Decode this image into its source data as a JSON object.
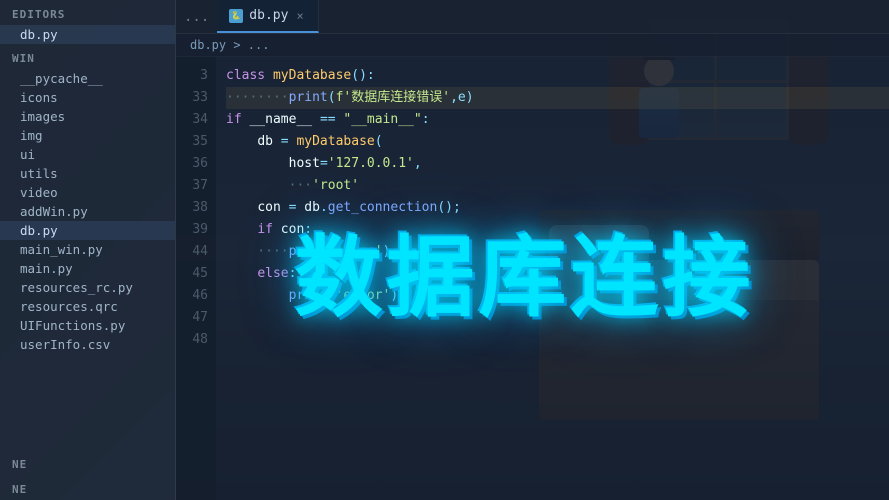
{
  "sidebar": {
    "editors_label": "EDITORS",
    "win_label": "WIN",
    "active_file": "db.py",
    "files": [
      {
        "name": "db.py",
        "active": true,
        "indent": 0
      },
      {
        "name": "__pycache__",
        "indent": 0,
        "is_folder": true
      },
      {
        "name": "icons",
        "indent": 0,
        "is_folder": true
      },
      {
        "name": "images",
        "indent": 0,
        "is_folder": true
      },
      {
        "name": "img",
        "indent": 0,
        "is_folder": true
      },
      {
        "name": "ui",
        "indent": 0,
        "is_folder": true
      },
      {
        "name": "utils",
        "indent": 0,
        "is_folder": true
      },
      {
        "name": "video",
        "indent": 0,
        "is_folder": true
      },
      {
        "name": "addWin.py",
        "indent": 0
      },
      {
        "name": "db.py",
        "indent": 0,
        "active2": true
      },
      {
        "name": "main_win.py",
        "indent": 0
      },
      {
        "name": "main.py",
        "indent": 0
      },
      {
        "name": "resources_rc.py",
        "indent": 0
      },
      {
        "name": "resources.qrc",
        "indent": 0
      },
      {
        "name": "UIFunctions.py",
        "indent": 0
      },
      {
        "name": "userInfo.csv",
        "indent": 0
      }
    ],
    "bottom_items": [
      "NE",
      "NE"
    ]
  },
  "tab": {
    "label": "db.py",
    "ellipsis": "...",
    "breadcrumb": "db.py > ..."
  },
  "code": {
    "lines": [
      {
        "num": "3",
        "content": "class myDatabase():"
      },
      {
        "num": "33",
        "content": "        ····print(f'数据库连接错误',e)"
      },
      {
        "num": "34",
        "content": ""
      },
      {
        "num": "35",
        "content": ""
      },
      {
        "num": "36",
        "content": "if __name__ == \"__main__\":"
      },
      {
        "num": "37",
        "content": "    db = myDatabase("
      },
      {
        "num": "38",
        "content": "        host='127.0.0.1',"
      },
      {
        "num": "39",
        "content": "        ···'root'"
      },
      {
        "num": "44",
        "content": "    con = db.get_connection();"
      },
      {
        "num": "45",
        "content": "    if con:"
      },
      {
        "num": "46",
        "content": "        ····print('succ')"
      },
      {
        "num": "47",
        "content": "    else:"
      },
      {
        "num": "48",
        "content": "        ····print('error')"
      }
    ]
  },
  "big_title": {
    "text": "数据库连接"
  },
  "colors": {
    "accent": "#00e5ff",
    "bg_dark": "#1a2535",
    "sidebar_bg": "#1e2837",
    "editor_bg": "#141e2d"
  }
}
